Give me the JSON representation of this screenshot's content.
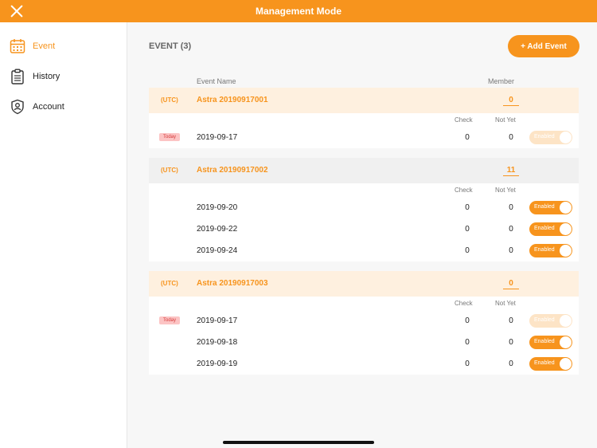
{
  "topbar": {
    "title": "Management Mode"
  },
  "sidebar": {
    "items": [
      {
        "label": "Event",
        "icon": "calendar-icon",
        "active": true
      },
      {
        "label": "History",
        "icon": "clipboard-icon",
        "active": false
      },
      {
        "label": "Account",
        "icon": "shield-user-icon",
        "active": false
      }
    ]
  },
  "main": {
    "header": "EVENT (3)",
    "add_button": "+ Add Event",
    "col_event_name": "Event Name",
    "col_member": "Member",
    "col_check": "Check",
    "col_not_yet": "Not Yet",
    "utc_label": "(UTC)",
    "today_label": "Today",
    "enabled_label": "Enabled",
    "events": [
      {
        "name": "Astra 20190917001",
        "member": "0",
        "sessions": [
          {
            "date": "2019-09-17",
            "check": "0",
            "not_yet": "0",
            "today": true,
            "faded": true
          }
        ]
      },
      {
        "name": "Astra 20190917002",
        "member": "11",
        "sessions": [
          {
            "date": "2019-09-20",
            "check": "0",
            "not_yet": "0",
            "today": false,
            "faded": false
          },
          {
            "date": "2019-09-22",
            "check": "0",
            "not_yet": "0",
            "today": false,
            "faded": false
          },
          {
            "date": "2019-09-24",
            "check": "0",
            "not_yet": "0",
            "today": false,
            "faded": false
          }
        ]
      },
      {
        "name": "Astra 20190917003",
        "member": "0",
        "sessions": [
          {
            "date": "2019-09-17",
            "check": "0",
            "not_yet": "0",
            "today": true,
            "faded": true
          },
          {
            "date": "2019-09-18",
            "check": "0",
            "not_yet": "0",
            "today": false,
            "faded": false
          },
          {
            "date": "2019-09-19",
            "check": "0",
            "not_yet": "0",
            "today": false,
            "faded": false
          }
        ]
      }
    ]
  },
  "colors": {
    "accent": "#f7941d",
    "today_bg": "#fcc4c4",
    "today_text": "#d43a3a"
  }
}
